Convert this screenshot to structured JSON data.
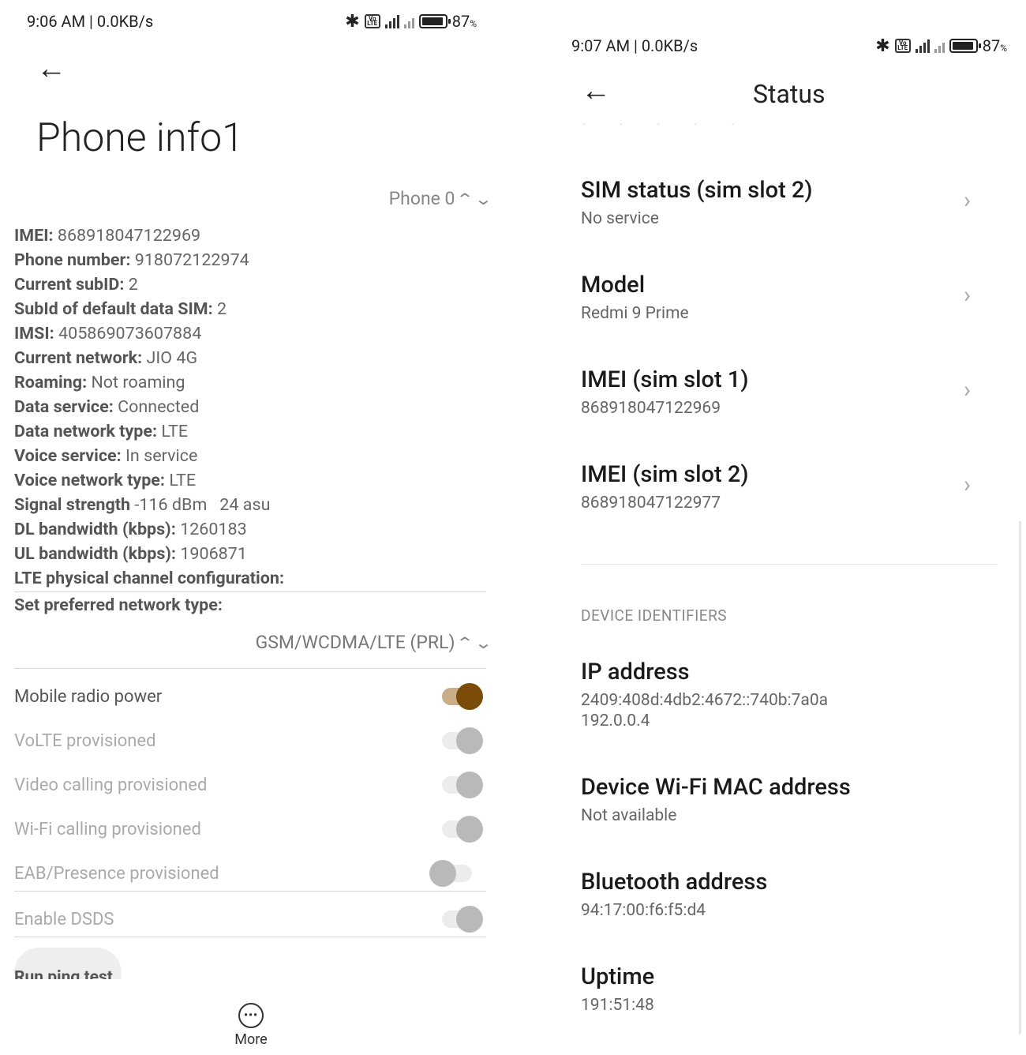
{
  "left": {
    "statusbar": {
      "time": "9:06 AM | 0.0KB/s",
      "battery": "87",
      "battery_unit": "%"
    },
    "title": "Phone info1",
    "phone_select": "Phone 0",
    "info": [
      {
        "k": "IMEI:",
        "v": " 868918047122969"
      },
      {
        "k": "Phone number:",
        "v": " 918072122974"
      },
      {
        "k": "Current subID:",
        "v": " 2"
      },
      {
        "k": "SubId of default data SIM:",
        "v": " 2"
      },
      {
        "k": "IMSI:",
        "v": " 405869073607884"
      },
      {
        "k": "Current network:",
        "v": " JIO 4G"
      },
      {
        "k": "Roaming:",
        "v": " Not roaming"
      },
      {
        "k": "Data service:",
        "v": " Connected"
      },
      {
        "k": "Data network type:",
        "v": " LTE"
      },
      {
        "k": "Voice service:",
        "v": " In service"
      },
      {
        "k": "Voice network type:",
        "v": " LTE"
      },
      {
        "k": "Signal strength",
        "v": " -116 dBm   24 asu"
      },
      {
        "k": "DL bandwidth (kbps):",
        "v": " 1260183"
      },
      {
        "k": "UL bandwidth (kbps):",
        "v": " 1906871"
      },
      {
        "k": "LTE physical channel configuration:",
        "v": ""
      }
    ],
    "pref_label": "Set preferred network type:",
    "pref_value": "GSM/WCDMA/LTE (PRL)",
    "toggles": [
      {
        "label": "Mobile radio power",
        "state": "on"
      },
      {
        "label": "VoLTE provisioned",
        "state": "disabled-on"
      },
      {
        "label": "Video calling provisioned",
        "state": "disabled-on"
      },
      {
        "label": "Wi-Fi calling provisioned",
        "state": "disabled-on"
      },
      {
        "label": "EAB/Presence provisioned",
        "state": "disabled-off"
      },
      {
        "label": "Enable DSDS",
        "state": "disabled-on"
      }
    ],
    "ping_button": "Run ping test",
    "more_label": "More"
  },
  "right": {
    "statusbar": {
      "time": "9:07 AM | 0.0KB/s",
      "battery": "87",
      "battery_unit": "%"
    },
    "title": "Status",
    "items": [
      {
        "title": "SIM status (sim slot 2)",
        "sub": "No service"
      },
      {
        "title": "Model",
        "sub": "Redmi 9 Prime"
      },
      {
        "title": "IMEI (sim slot 1)",
        "sub": "868918047122969"
      },
      {
        "title": "IMEI (sim slot 2)",
        "sub": "868918047122977"
      }
    ],
    "section_header": "DEVICE IDENTIFIERS",
    "identifiers": [
      {
        "title": "IP address",
        "sub1": "2409:408d:4db2:4672::740b:7a0a",
        "sub2": "192.0.0.4"
      },
      {
        "title": "Device Wi-Fi MAC address",
        "sub1": "Not available"
      },
      {
        "title": "Bluetooth address",
        "sub1": "94:17:00:f6:f5:d4"
      },
      {
        "title": "Uptime",
        "sub1": "191:51:48"
      }
    ]
  },
  "icons": {
    "back": "back-arrow-icon",
    "chevron": "chevron-right-icon",
    "more": "more-horizontal-icon",
    "bluetooth": "bluetooth-icon",
    "volte": "volte-icon",
    "signal": "signal-icon",
    "battery": "battery-icon"
  },
  "colors": {
    "toggle_on_knob": "#7a4c07",
    "toggle_on_track": "#c9ad86",
    "toggle_disabled_knob": "#b9b9b9"
  }
}
